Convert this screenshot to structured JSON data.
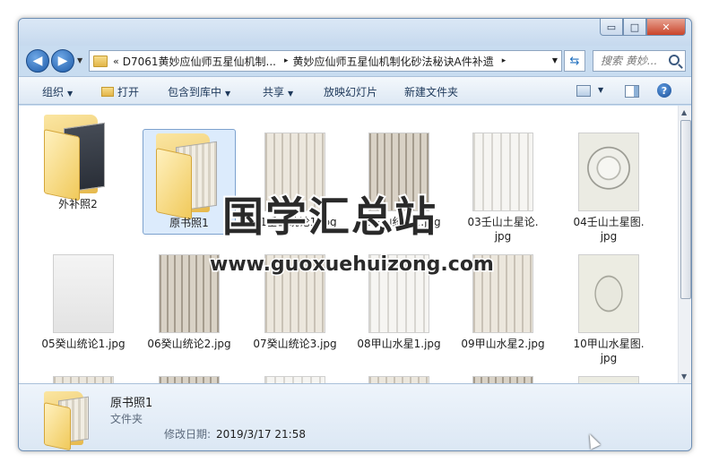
{
  "window": {
    "min_label": "▭",
    "max_label": "□",
    "close_label": "✕"
  },
  "address": {
    "overflow": "«",
    "crumbs": [
      "D7061黄妙应仙师五星仙机制...",
      "黄妙应仙师五星仙机制化砂法秘诀A件补遗"
    ],
    "sep": "▸"
  },
  "search": {
    "placeholder": "搜索 黄妙..."
  },
  "toolbar": {
    "organize": "组织",
    "open": "打开",
    "include_library": "包含到库中",
    "share": "共享",
    "slideshow": "放映幻灯片",
    "new_folder": "新建文件夹",
    "help": "?"
  },
  "items": [
    {
      "name": "外补照2",
      "type": "folder-dark"
    },
    {
      "name": "原书照1",
      "type": "folder",
      "selected": true
    },
    {
      "name": "01壬山统论1.jpg",
      "type": "t-text"
    },
    {
      "name": "02壬山统论2.jpg",
      "type": "t-text2"
    },
    {
      "name": "03壬山土星论.jpg",
      "type": "t-light"
    },
    {
      "name": "04壬山土星图.jpg",
      "type": "t-map"
    },
    {
      "name": "05癸山统论1.jpg",
      "type": "t-plain"
    },
    {
      "name": "06癸山统论2.jpg",
      "type": "t-text2"
    },
    {
      "name": "07癸山统论3.jpg",
      "type": "t-text"
    },
    {
      "name": "08甲山水星1.jpg",
      "type": "t-light"
    },
    {
      "name": "09甲山水星2.jpg",
      "type": "t-text"
    },
    {
      "name": "10甲山水星图.jpg",
      "type": "t-map2"
    },
    {
      "name": "",
      "type": "t-text"
    },
    {
      "name": "",
      "type": "t-text2"
    },
    {
      "name": "",
      "type": "t-light"
    },
    {
      "name": "",
      "type": "t-text"
    },
    {
      "name": "",
      "type": "t-text2"
    },
    {
      "name": "",
      "type": "t-map2"
    }
  ],
  "item_labels": {
    "i0": "外补照2",
    "i1": "原书照1",
    "i2": "01壬山统论1.jpg",
    "i3": "02壬山统论2.jpg",
    "i4a": "03壬山土星论.",
    "i4b": "jpg",
    "i5a": "04壬山土星图.",
    "i5b": "jpg",
    "i6": "05癸山统论1.jpg",
    "i7": "06癸山统论2.jpg",
    "i8": "07癸山统论3.jpg",
    "i9": "08甲山水星1.jpg",
    "i10": "09甲山水星2.jpg",
    "i11a": "10甲山水星图.",
    "i11b": "jpg"
  },
  "details": {
    "name": "原书照1",
    "type": "文件夹",
    "modified_label": "修改日期:",
    "modified_value": "2019/3/17 21:58"
  },
  "watermark": {
    "line1": "国学汇总站",
    "line2": "www.guoxuehuizong.com"
  }
}
